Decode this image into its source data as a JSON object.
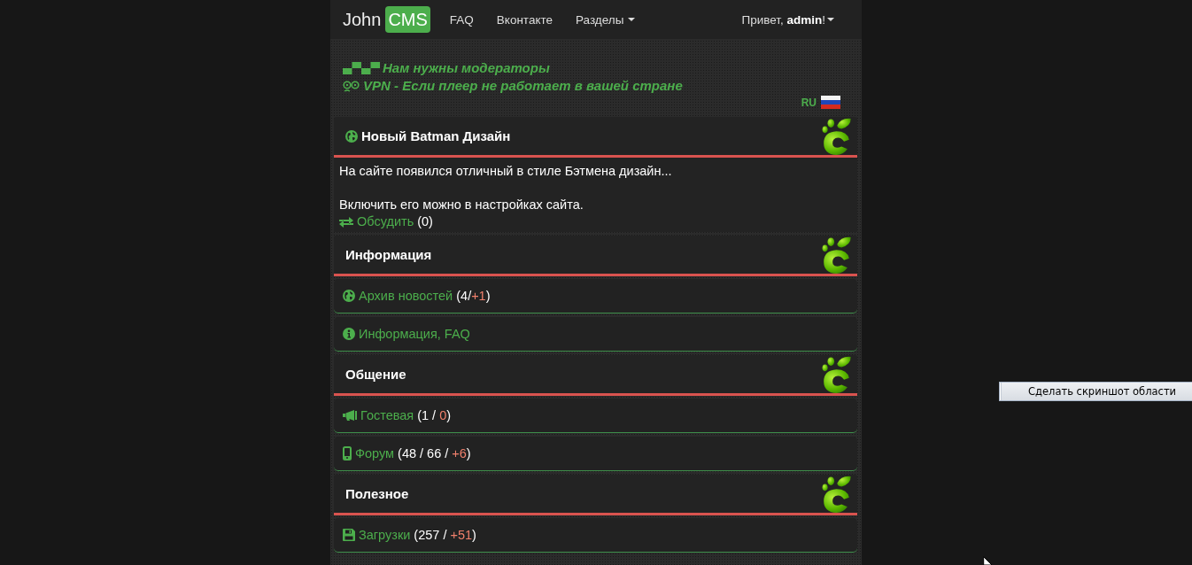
{
  "navbar": {
    "brand": {
      "text": "John",
      "badge": "CMS"
    },
    "links": [
      {
        "label": "FAQ",
        "dropdown": false
      },
      {
        "label": "Вконтакте",
        "dropdown": false
      },
      {
        "label": "Разделы",
        "dropdown": true
      }
    ],
    "user": {
      "greeting": "Привет, **admin**!",
      "dropdown": true
    }
  },
  "notices": [
    {
      "kind": "recruit",
      "text": "Нам нужны модераторы"
    },
    {
      "kind": "vpn",
      "text": "VPN - Если плеер не работает в вашей стране"
    }
  ],
  "language": {
    "code": "RU"
  },
  "news": {
    "title": "Новый Batman Дизайн",
    "paragraphs": [
      "На сайте появился отличный в стиле Бэтмена дизайн...",
      "Включить его можно в настройках сайта."
    ],
    "discuss": {
      "label": "Обсудить",
      "count": [
        {
          "text": "(0)",
          "kind": "plain"
        }
      ]
    }
  },
  "sections": [
    {
      "title": "Информация",
      "items": [
        {
          "kind": "news",
          "label": "Архив новостей",
          "count": [
            {
              "text": "(4/",
              "kind": "plain"
            },
            {
              "text": "+1",
              "kind": "new"
            },
            {
              "text": ")",
              "kind": "plain"
            }
          ]
        },
        {
          "kind": "about",
          "label": "Информация, FAQ"
        }
      ]
    },
    {
      "title": "Общение",
      "items": [
        {
          "kind": "guestbook",
          "label": "Гостевая",
          "count": [
            {
              "text": "(1 / ",
              "kind": "plain"
            },
            {
              "text": "0",
              "kind": "new"
            },
            {
              "text": ")",
              "kind": "plain"
            }
          ]
        },
        {
          "kind": "forum",
          "label": "Форум",
          "count": [
            {
              "text": "(48 / 66 / ",
              "kind": "plain"
            },
            {
              "text": "+6",
              "kind": "new"
            },
            {
              "text": ")",
              "kind": "plain"
            }
          ]
        }
      ]
    },
    {
      "title": "Полезное",
      "items": [
        {
          "kind": "downloads",
          "label": "Загрузки",
          "count": [
            {
              "text": "(257 / ",
              "kind": "plain"
            },
            {
              "text": "+51",
              "kind": "new"
            },
            {
              "text": ")",
              "kind": "plain"
            }
          ]
        }
      ]
    }
  ],
  "context_menu": {
    "items": [
      "Сделать скриншот области"
    ]
  }
}
